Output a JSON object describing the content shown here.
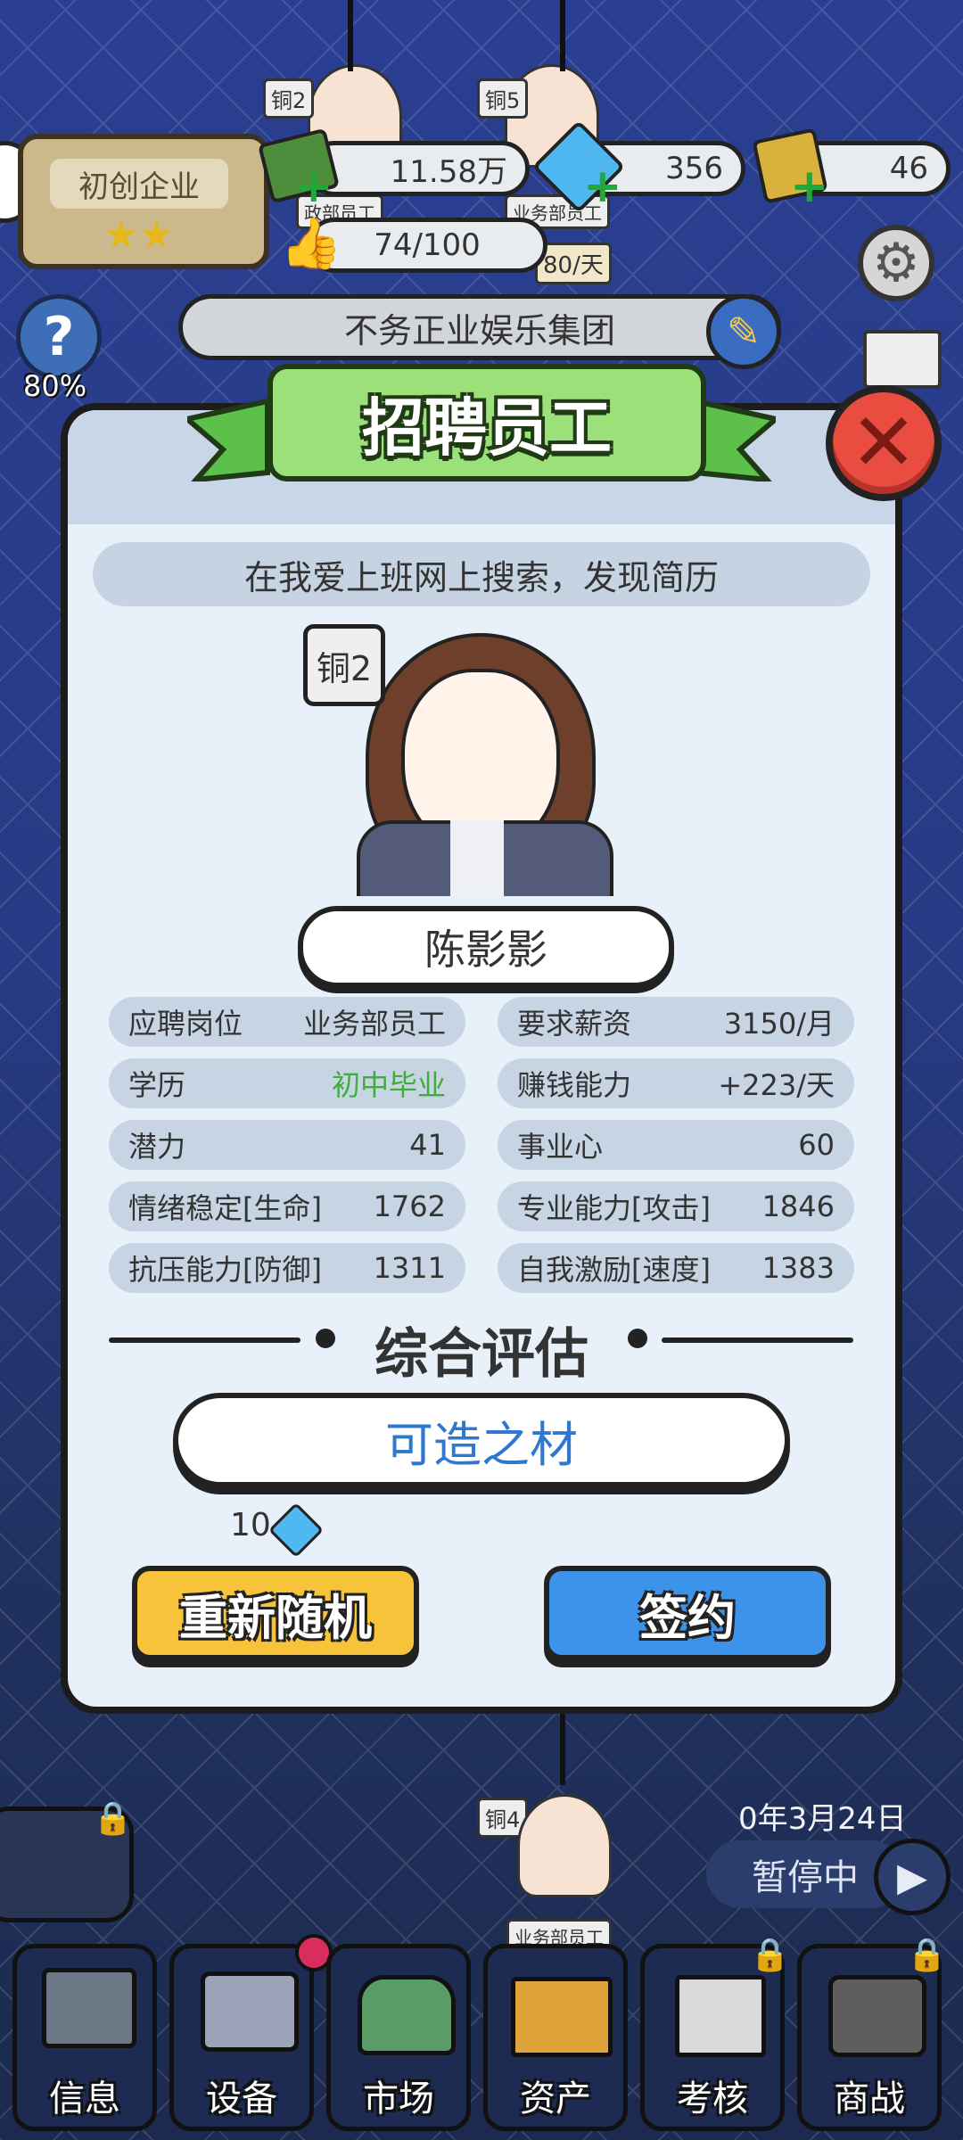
{
  "hud": {
    "company_level": "初创企业",
    "money": "11.58万",
    "diamonds": "356",
    "tickets": "46",
    "satisfaction": "74/100",
    "help_percent": "80%",
    "company_name": "不务正业娱乐集团",
    "rate": "80/天",
    "bg_tags": [
      "铜2",
      "铜5",
      "铜4"
    ],
    "bg_roles": [
      "政部员工",
      "业务部员工",
      "业务部员工"
    ]
  },
  "modal": {
    "title": "招聘员工",
    "source": "在我爱上班网上搜索，发现简历",
    "rank": "铜2",
    "name": "陈影影",
    "stats_left": [
      {
        "label": "应聘岗位",
        "value": "业务部员工"
      },
      {
        "label": "学历",
        "value": "初中毕业"
      },
      {
        "label": "潜力",
        "value": "41"
      },
      {
        "label": "情绪稳定[生命]",
        "value": "1762"
      },
      {
        "label": "抗压能力[防御]",
        "value": "1311"
      }
    ],
    "stats_right": [
      {
        "label": "要求薪资",
        "value": "3150/月"
      },
      {
        "label": "赚钱能力",
        "value": "+223/天"
      },
      {
        "label": "事业心",
        "value": "60"
      },
      {
        "label": "专业能力[攻击]",
        "value": "1846"
      },
      {
        "label": "自我激励[速度]",
        "value": "1383"
      }
    ],
    "eval_title": "综合评估",
    "eval_result": "可造之材",
    "reroll_cost": "10",
    "reroll_label": "重新随机",
    "sign_label": "签约",
    "education_color": "#3fae3a",
    "eval_color": "#2f78d0"
  },
  "status": {
    "date": "0年3月24日",
    "pause_label": "暂停中"
  },
  "nav": [
    {
      "label": "信息"
    },
    {
      "label": "设备"
    },
    {
      "label": "市场"
    },
    {
      "label": "资产"
    },
    {
      "label": "考核"
    },
    {
      "label": "商战"
    }
  ]
}
